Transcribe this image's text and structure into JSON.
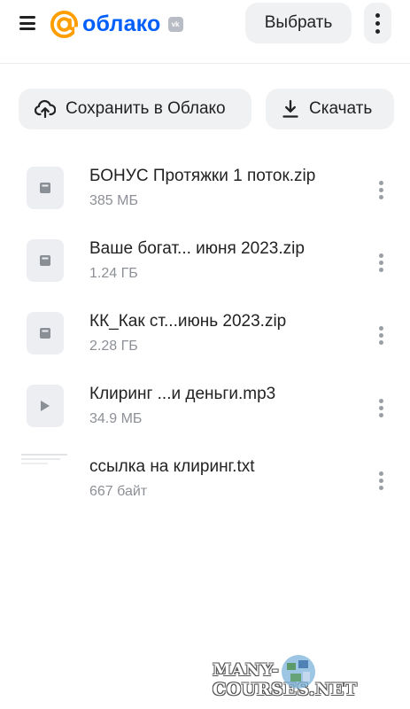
{
  "header": {
    "logo_text": "облако",
    "logo_badge": "vk",
    "select_label": "Выбрать"
  },
  "actions": {
    "save_label": "Сохранить в Облако",
    "download_label": "Скачать"
  },
  "files": [
    {
      "name": "БОНУС Протяжки 1 поток.zip",
      "size": "385 МБ",
      "type": "archive"
    },
    {
      "name": "Ваше богат... июня 2023.zip",
      "size": "1.24 ГБ",
      "type": "archive"
    },
    {
      "name": "КК_Как ст...июнь 2023.zip",
      "size": "2.28 ГБ",
      "type": "archive"
    },
    {
      "name": "Клиринг ...и деньги.mp3",
      "size": "34.9 МБ",
      "type": "audio"
    },
    {
      "name": "ссылка на клиринг.txt",
      "size": "667 байт",
      "type": "text"
    }
  ],
  "watermark": {
    "text": "MANY-COURSES.NET"
  },
  "colors": {
    "brand": "#005ff9",
    "accent": "#ff9e00",
    "button_bg": "#f0f1f3",
    "secondary_text": "#8c9096"
  },
  "icons": {
    "menu": "hamburger-icon",
    "more": "vertical-dots-icon",
    "save": "cloud-upload-icon",
    "download": "download-icon",
    "archive": "archive-file-icon",
    "audio": "play-icon"
  }
}
